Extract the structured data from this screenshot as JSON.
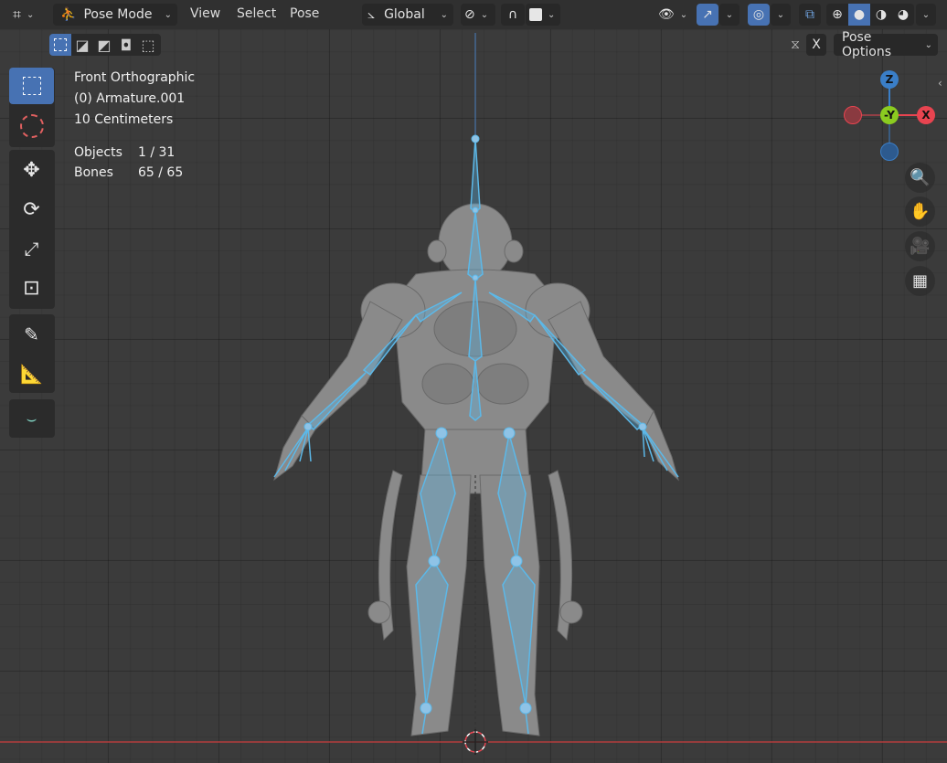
{
  "header": {
    "mode_label": "Pose Mode",
    "menus": [
      "View",
      "Select",
      "Pose"
    ],
    "orientation_label": "Global",
    "pose_options_label": "Pose Options",
    "x_mirror_label": "X"
  },
  "overlay": {
    "view_name": "Front Orthographic",
    "object_name": "(0) Armature.001",
    "scale": "10 Centimeters",
    "objects_label": "Objects",
    "objects_value": "1 / 31",
    "bones_label": "Bones",
    "bones_value": "65 / 65"
  },
  "gizmo": {
    "z": "Z",
    "y": "-Y",
    "x": "X"
  },
  "icons": {
    "editor_type": "editor-type-icon",
    "mode": "pose-mode-icon",
    "transform": "transform-orientation-icon",
    "snap": "magnet-icon",
    "proportional": "proportional-icon",
    "visibility": "eye-icon",
    "gizmos": "gizmo-icon",
    "overlays": "overlay-icon",
    "xray": "xray-icon",
    "shading": [
      "wireframe-icon",
      "solid-icon",
      "material-icon",
      "rendered-icon"
    ],
    "tools": [
      "select-box-icon",
      "cursor-icon",
      "move-icon",
      "rotate-icon",
      "scale-icon",
      "transform-icon",
      "annotate-icon",
      "measure-icon",
      "relax-icon"
    ],
    "nav": [
      "zoom-icon",
      "hand-icon",
      "camera-icon",
      "grid-icon"
    ]
  },
  "colors": {
    "accent": "#4772b3",
    "bone": "#5cb8e8",
    "x_axis": "#e84450",
    "y_axis": "#8bcb20",
    "z_axis": "#3a7ec7",
    "mesh": "#8a8a8a"
  }
}
